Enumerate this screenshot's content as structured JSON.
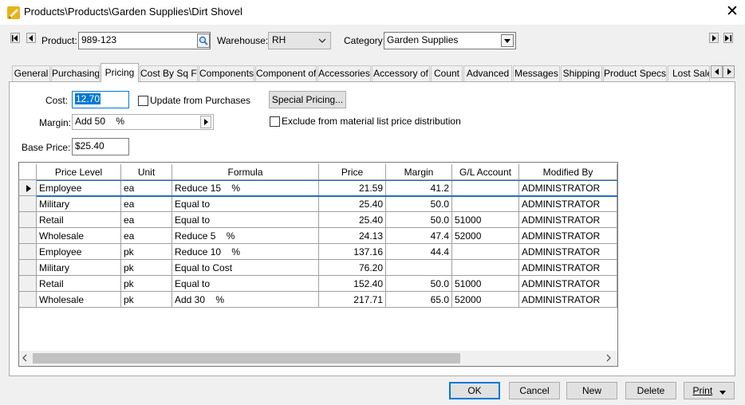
{
  "window": {
    "title": "Products\\Products\\Garden Supplies\\Dirt Shovel",
    "close_symbol": "✕"
  },
  "header": {
    "product_label": "Product:",
    "product_value": "989-123",
    "warehouse_label": "Warehouse:",
    "warehouse_value": "RH",
    "category_label": "Category:",
    "category_value": "Garden Supplies"
  },
  "tabs": [
    {
      "label": "General"
    },
    {
      "label": "Purchasing"
    },
    {
      "label": "Pricing"
    },
    {
      "label": "Cost By Sq Ft"
    },
    {
      "label": "Components"
    },
    {
      "label": "Component of"
    },
    {
      "label": "Accessories"
    },
    {
      "label": "Accessory of"
    },
    {
      "label": "Count"
    },
    {
      "label": "Advanced"
    },
    {
      "label": "Messages"
    },
    {
      "label": "Shipping"
    },
    {
      "label": "Product Specs"
    },
    {
      "label": "Lost Sale"
    }
  ],
  "pricing": {
    "cost_label": "Cost:",
    "cost_value": "12.70",
    "update_from_purchases_label": "Update from Purchases",
    "special_pricing_label": "Special Pricing...",
    "margin_label": "Margin:",
    "margin_value": "Add 50    %",
    "exclude_label": "Exclude from material list price distribution",
    "base_price_label": "Base Price:",
    "base_price_value": "$25.40"
  },
  "grid": {
    "columns": [
      "Price Level",
      "Unit",
      "Formula",
      "Price",
      "Margin",
      "G/L Account",
      "Modified By"
    ],
    "rows": [
      [
        "Employee",
        "ea",
        "Reduce 15    %",
        "21.59",
        "41.2",
        "",
        "ADMINISTRATOR"
      ],
      [
        "Military",
        "ea",
        "Equal to",
        "25.40",
        "50.0",
        "",
        "ADMINISTRATOR"
      ],
      [
        "Retail",
        "ea",
        "Equal to",
        "25.40",
        "50.0",
        "51000",
        "ADMINISTRATOR"
      ],
      [
        "Wholesale",
        "ea",
        "Reduce 5    %",
        "24.13",
        "47.4",
        "52000",
        "ADMINISTRATOR"
      ],
      [
        "Employee",
        "pk",
        "Reduce 10    %",
        "137.16",
        "44.4",
        "",
        "ADMINISTRATOR"
      ],
      [
        "Military",
        "pk",
        "Equal to Cost",
        "76.20",
        "",
        "",
        "ADMINISTRATOR"
      ],
      [
        "Retail",
        "pk",
        "Equal to",
        "152.40",
        "50.0",
        "51000",
        "ADMINISTRATOR"
      ],
      [
        "Wholesale",
        "pk",
        "Add 30    %",
        "217.71",
        "65.0",
        "52000",
        "ADMINISTRATOR"
      ]
    ]
  },
  "buttons": {
    "ok": "OK",
    "cancel": "Cancel",
    "new": "New",
    "delete": "Delete",
    "print": "Print"
  },
  "colors": {
    "selection_accent": "#1f6fc5",
    "default_button_border": "#0078d7"
  }
}
